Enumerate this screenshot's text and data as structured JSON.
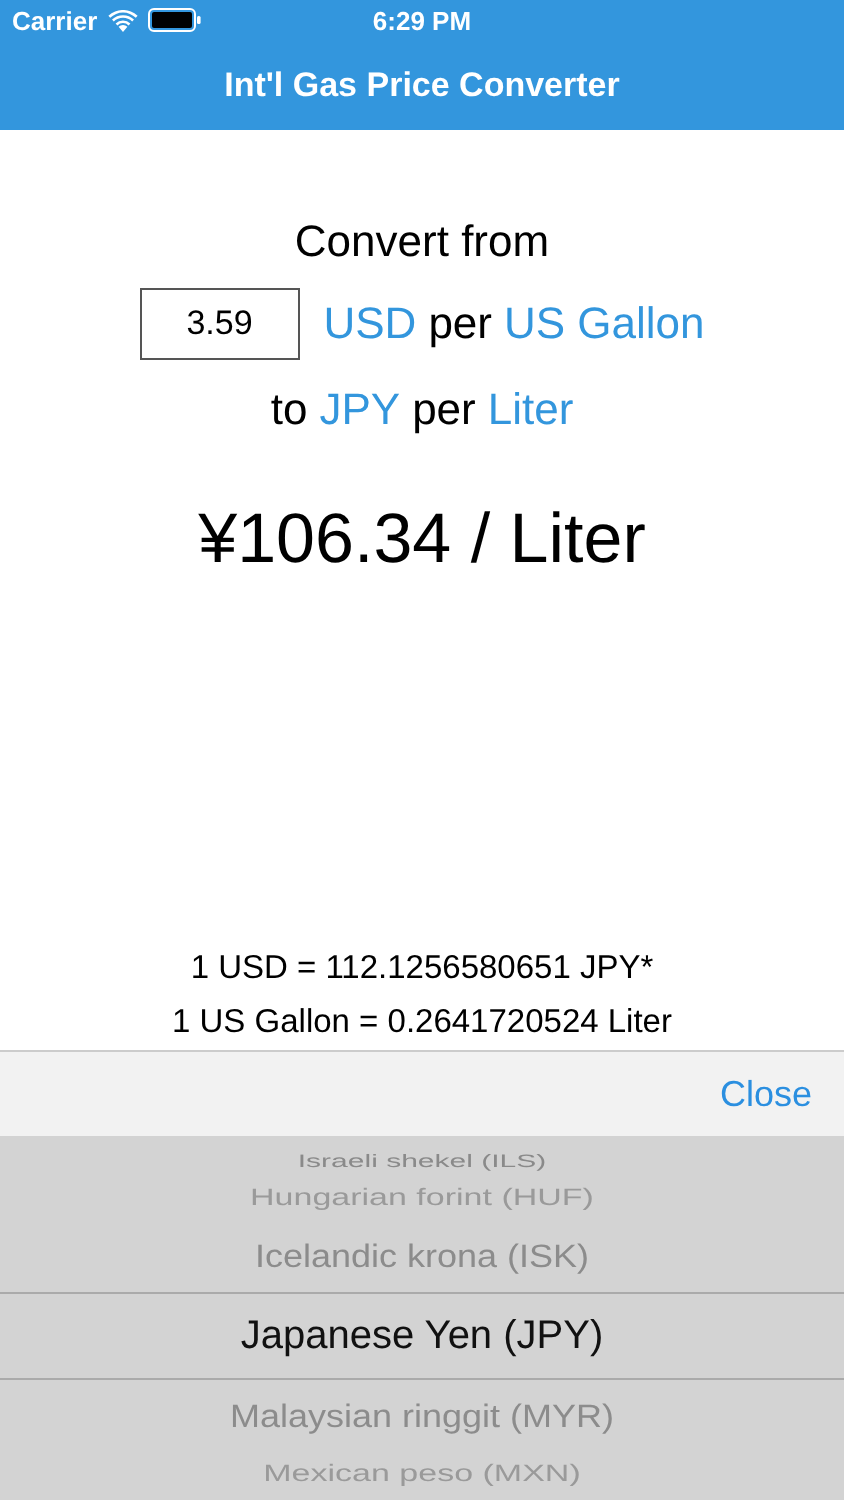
{
  "status_bar": {
    "carrier": "Carrier",
    "time": "6:29 PM"
  },
  "nav": {
    "title": "Int'l Gas Price Converter"
  },
  "converter": {
    "heading": "Convert from",
    "amount": {
      "value": "3.59"
    },
    "from_currency": "USD",
    "from_per": "per",
    "from_unit": "US Gallon",
    "to_prefix": "to",
    "to_currency": "JPY",
    "to_per": "per",
    "to_unit": "Liter",
    "result": "¥106.34 / Liter",
    "rates": [
      "1 USD = 112.1256580651 JPY*",
      "1 US Gallon = 0.2641720524 Liter"
    ]
  },
  "toolbar": {
    "close": "Close"
  },
  "picker": {
    "items": [
      {
        "label": "Israeli shekel (ILS)",
        "selected": false
      },
      {
        "label": "Hungarian forint (HUF)",
        "selected": false
      },
      {
        "label": "Icelandic krona (ISK)",
        "selected": false
      },
      {
        "label": "Japanese Yen (JPY)",
        "selected": true
      },
      {
        "label": "Malaysian ringgit (MYR)",
        "selected": false
      },
      {
        "label": "Mexican peso (MXN)",
        "selected": false
      }
    ]
  }
}
